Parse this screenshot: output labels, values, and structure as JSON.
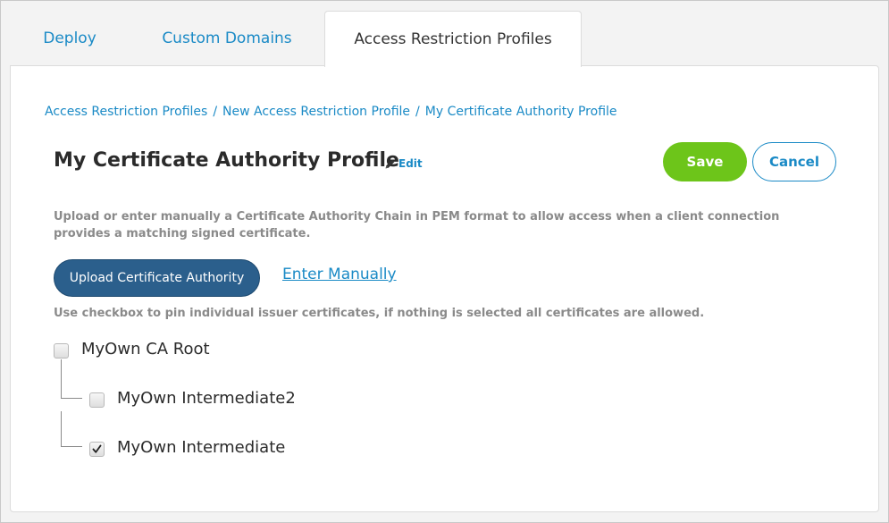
{
  "tabs": [
    {
      "label": "Deploy",
      "active": false
    },
    {
      "label": "Custom Domains",
      "active": false
    },
    {
      "label": "Access Restriction Profiles",
      "active": true
    }
  ],
  "breadcrumb": [
    "Access Restriction Profiles",
    "New Access Restriction Profile",
    "My Certificate Authority Profile"
  ],
  "breadcrumb_separator": "/",
  "page": {
    "title": "My Certificate Authority Profile",
    "edit_label": "Edit"
  },
  "actions": {
    "save_label": "Save",
    "cancel_label": "Cancel"
  },
  "description": "Upload or enter manually a Certificate Authority Chain in PEM format to allow access when a client connection provides a matching signed certificate.",
  "upload_label": "Upload Certificate Authority",
  "enter_manually_label": "Enter Manually",
  "hint": "Use checkbox to pin individual issuer certificates, if nothing is selected all certificates are allowed.",
  "certificates": [
    {
      "label": "MyOwn CA Root",
      "checked": false
    },
    {
      "label": "MyOwn Intermediate2",
      "checked": false
    },
    {
      "label": "MyOwn Intermediate",
      "checked": true
    }
  ],
  "colors": {
    "link": "#1a8ac6",
    "save": "#6dc51a",
    "upload": "#2b5f8c"
  }
}
